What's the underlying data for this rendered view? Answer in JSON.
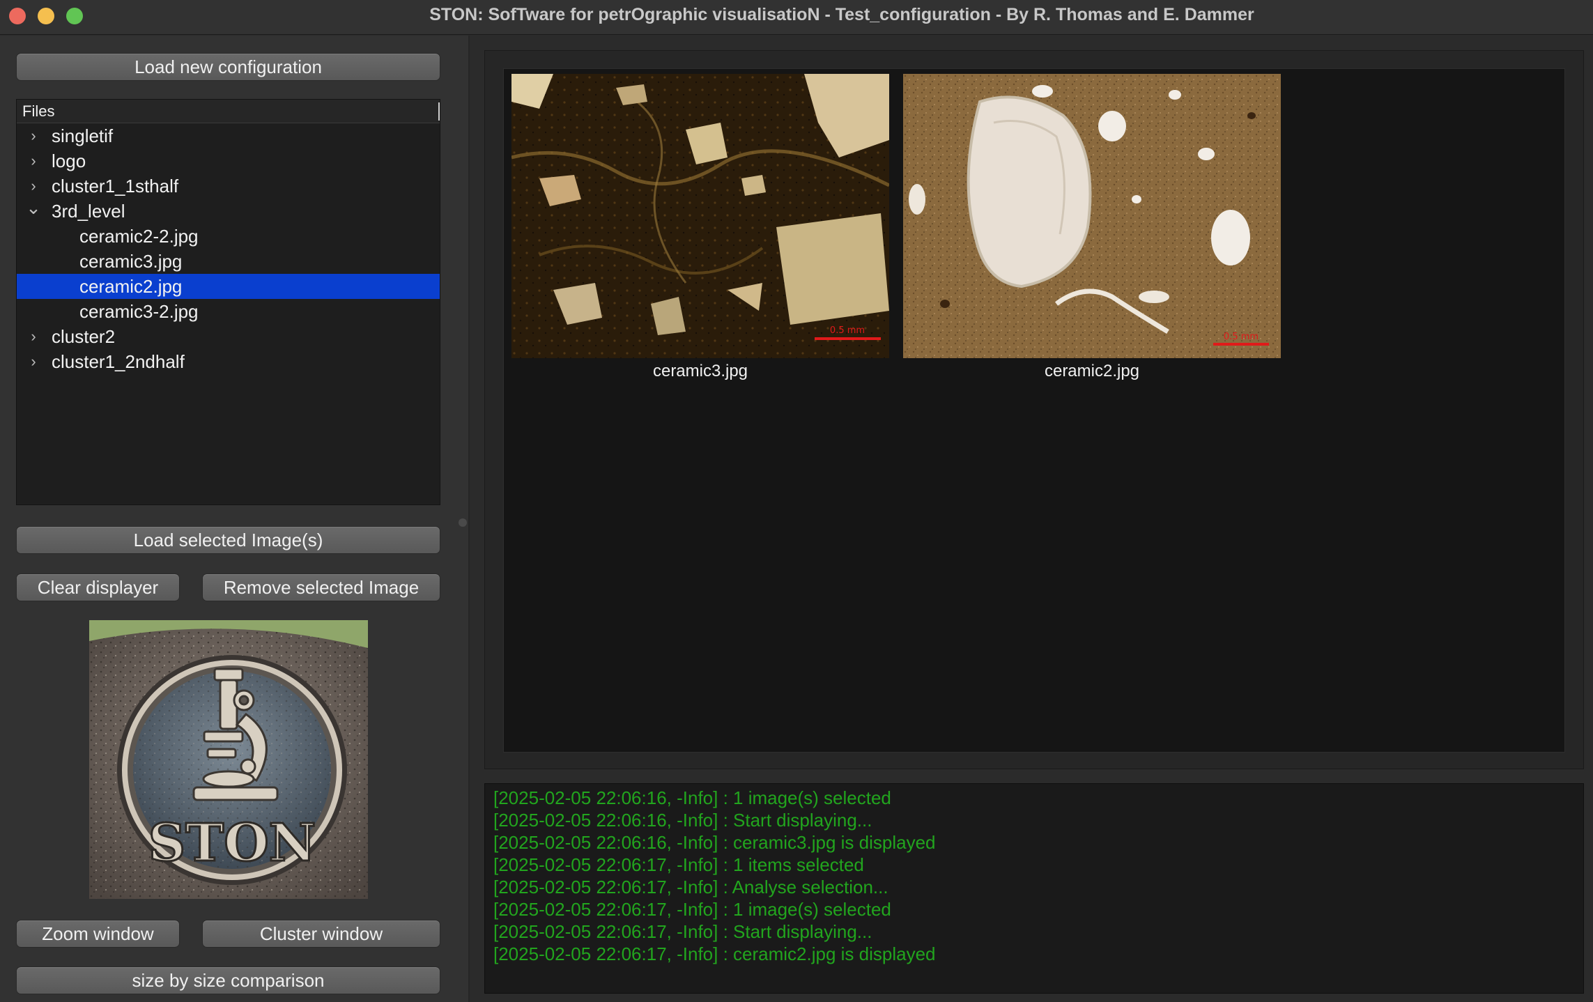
{
  "window": {
    "title": "STON: SofTware for petrOgraphic visualisatioN - Test_configuration - By R. Thomas and E. Dammer"
  },
  "left_panel": {
    "load_config_label": "Load new configuration",
    "tree_header": "Files",
    "tree": [
      {
        "label": "singletif",
        "expanded": false,
        "level": 0
      },
      {
        "label": "logo",
        "expanded": false,
        "level": 0
      },
      {
        "label": "cluster1_1sthalf",
        "expanded": false,
        "level": 0
      },
      {
        "label": "3rd_level",
        "expanded": true,
        "level": 0
      },
      {
        "label": "ceramic2-2.jpg",
        "level": 1
      },
      {
        "label": "ceramic3.jpg",
        "level": 1
      },
      {
        "label": "ceramic2.jpg",
        "level": 1,
        "selected": true
      },
      {
        "label": "ceramic3-2.jpg",
        "level": 1
      },
      {
        "label": "cluster2",
        "expanded": false,
        "level": 0
      },
      {
        "label": "cluster1_2ndhalf",
        "expanded": false,
        "level": 0
      }
    ],
    "load_selected_label": "Load selected Image(s)",
    "clear_label": "Clear displayer",
    "remove_label": "Remove selected Image",
    "logo_text": "STON",
    "zoom_label": "Zoom window",
    "cluster_label": "Cluster window",
    "compare_label": "size by size comparison"
  },
  "display": {
    "images": [
      {
        "caption": "ceramic3.jpg",
        "scale_label": "0.5 mm"
      },
      {
        "caption": "ceramic2.jpg",
        "scale_label": "0.5 mm"
      }
    ]
  },
  "log": [
    "[2025-02-05 22:06:16, -Info] : 1 image(s) selected",
    "[2025-02-05 22:06:16, -Info] : Start displaying...",
    "[2025-02-05 22:06:16, -Info] : ceramic3.jpg is displayed",
    "[2025-02-05 22:06:17, -Info] : 1 items selected",
    "[2025-02-05 22:06:17, -Info] : Analyse selection...",
    "[2025-02-05 22:06:17, -Info] : 1 image(s) selected",
    "[2025-02-05 22:06:17, -Info] : Start displaying...",
    "[2025-02-05 22:06:17, -Info] : ceramic2.jpg is displayed"
  ],
  "colors": {
    "selection": "#0a3fcf",
    "log_text": "#22a51e"
  }
}
